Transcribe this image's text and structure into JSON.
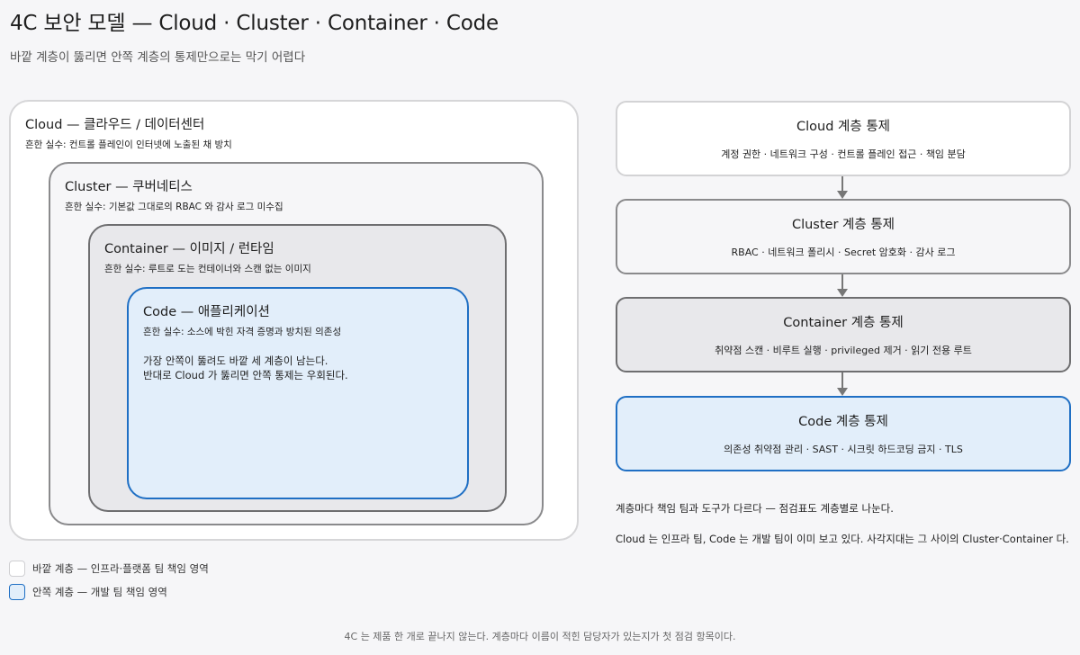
{
  "title": "4C 보안 모델 — Cloud · Cluster · Container · Code",
  "subtitle": "바깥 계층이 뚫리면 안쪽 계층의 통제만으로는 막기 어렵다",
  "layers": {
    "cloud": {
      "name": "Cloud — 클라우드 / 데이터센터",
      "mistake": "흔한 실수: 컨트롤 플레인이 인터넷에 노출된 채 방치"
    },
    "cluster": {
      "name": "Cluster — 쿠버네티스",
      "mistake": "흔한 실수: 기본값 그대로의 RBAC 와 감사 로그 미수집"
    },
    "container": {
      "name": "Container — 이미지 / 런타임",
      "mistake": "흔한 실수: 루트로 도는 컨테이너와 스캔 없는 이미지"
    },
    "code": {
      "name": "Code — 애플리케이션",
      "mistake": "흔한 실수: 소스에 박힌 자격 증명과 방치된 의존성",
      "note_line1": "가장 안쪽이 뚫려도 바깥 세 계층이 남는다.",
      "note_line2": "반대로 Cloud 가 뚫리면 안쪽 통제는 우회된다."
    }
  },
  "controls": [
    {
      "name": "Cloud 계층 통제",
      "items": "계정 권한 · 네트워크 구성 · 컨트롤 플레인 접근 · 책임 분담"
    },
    {
      "name": "Cluster 계층 통제",
      "items": "RBAC · 네트워크 폴리시 · Secret 암호화 · 감사 로그"
    },
    {
      "name": "Container 계층 통제",
      "items": "취약점 스캔 · 비루트 실행 · privileged 제거 · 읽기 전용 루트"
    },
    {
      "name": "Code 계층 통제",
      "items": "의존성 취약점 관리 · SAST · 시크릿 하드코딩 금지 · TLS"
    }
  ],
  "notes": {
    "line1": "계층마다 책임 팀과 도구가 다르다 — 점검표도 계층별로 나눈다.",
    "line2": "Cloud 는 인프라 팀, Code 는 개발 팀이 이미 보고 있다. 사각지대는 그 사이의 Cluster·Container 다."
  },
  "legend": {
    "outer": "바깥 계층 — 인프라·플랫폼 팀 책임 영역",
    "inner": "안쪽 계층 — 개발 팀 책임 영역"
  },
  "footer": "4C 는 제품 한 개로 끝나지 않는다. 계층마다 이름이 적힌 담당자가 있는지가 첫 점검 항목이다.",
  "colors": {
    "code_accent": "#1f6fc4",
    "code_fill": "#e2eefa",
    "container_fill": "#e8e8eb",
    "cloud_fill": "#ffffff"
  }
}
